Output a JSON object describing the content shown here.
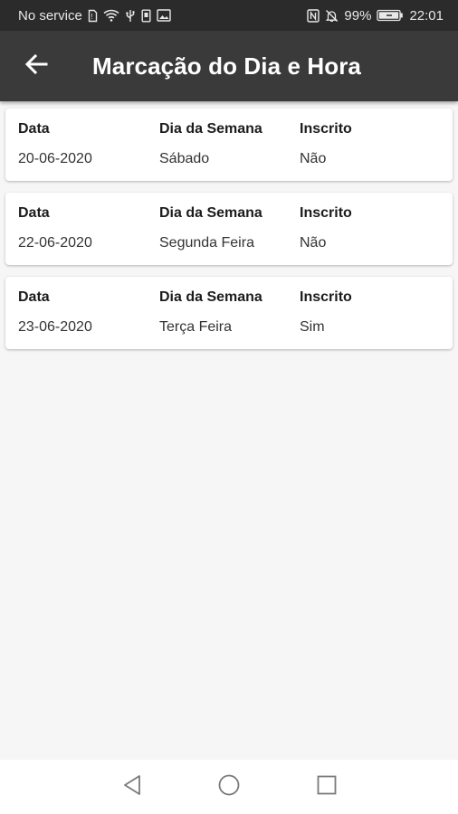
{
  "status_bar": {
    "carrier": "No service",
    "battery_percent": "99%",
    "time": "22:01"
  },
  "app_bar": {
    "title": "Marcação do Dia e Hora",
    "back_icon": "arrow-left-icon"
  },
  "headers": {
    "date": "Data",
    "weekday": "Dia da Semana",
    "enrolled": "Inscrito"
  },
  "entries": [
    {
      "date": "20-06-2020",
      "weekday": "Sábado",
      "enrolled": "Não"
    },
    {
      "date": "22-06-2020",
      "weekday": "Segunda Feira",
      "enrolled": "Não"
    },
    {
      "date": "23-06-2020",
      "weekday": "Terça Feira",
      "enrolled": "Sim"
    }
  ],
  "nav_bar": {
    "icons": [
      "back-triangle-icon",
      "home-circle-icon",
      "recents-square-icon"
    ]
  },
  "colors": {
    "status_bar_bg": "#2b2b2b",
    "app_bar_bg": "#3a3a3a",
    "page_bg": "#f6f6f6",
    "card_bg": "#ffffff"
  }
}
